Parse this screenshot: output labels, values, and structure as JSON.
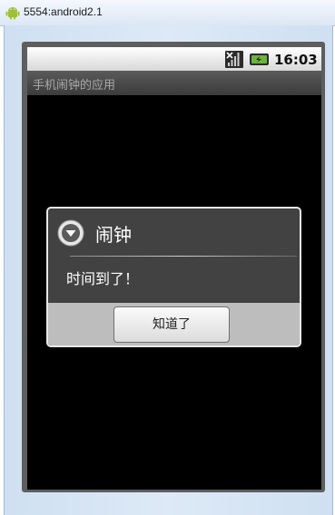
{
  "window": {
    "title": "5554:android2.1"
  },
  "status_bar": {
    "time": "16:03"
  },
  "app": {
    "title": "手机闹钟的应用"
  },
  "dialog": {
    "title": "闹钟",
    "message": "时间到了！",
    "button_label": "知道了"
  },
  "icons": {
    "window_icon": "android-logo-icon",
    "signal": "signal-strength-icon",
    "battery": "battery-charging-icon",
    "dialog_icon": "alert-dialog-icon"
  },
  "colors": {
    "screen_background": "#000000",
    "dialog_body": "#424242",
    "dialog_footer": "#bdbdbd",
    "battery_green": "#6db33f",
    "android_green": "#9fbf3b"
  }
}
